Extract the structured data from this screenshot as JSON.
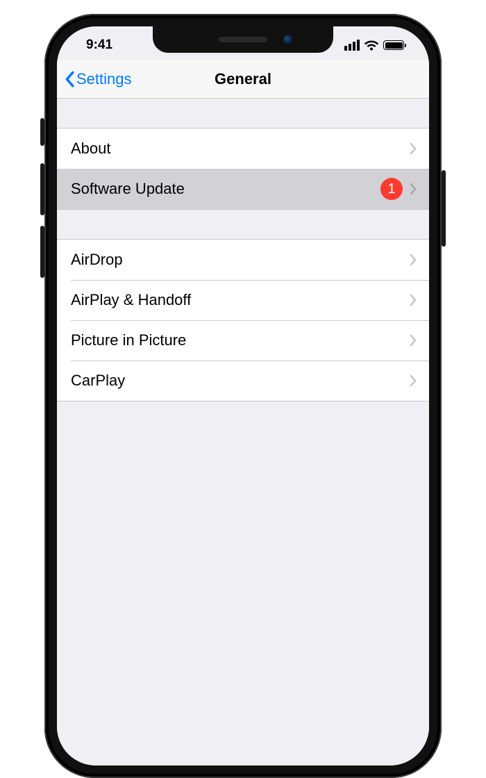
{
  "status": {
    "time": "9:41"
  },
  "nav": {
    "back": "Settings",
    "title": "General"
  },
  "groups": [
    {
      "rows": [
        {
          "label": "About",
          "badge": null,
          "highlight": false
        },
        {
          "label": "Software Update",
          "badge": "1",
          "highlight": true
        }
      ]
    },
    {
      "rows": [
        {
          "label": "AirDrop",
          "badge": null,
          "highlight": false
        },
        {
          "label": "AirPlay & Handoff",
          "badge": null,
          "highlight": false
        },
        {
          "label": "Picture in Picture",
          "badge": null,
          "highlight": false
        },
        {
          "label": "CarPlay",
          "badge": null,
          "highlight": false
        }
      ]
    }
  ]
}
